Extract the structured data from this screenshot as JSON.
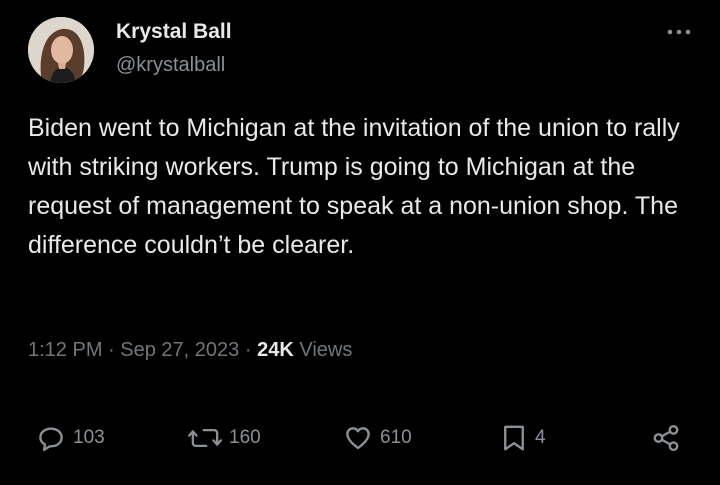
{
  "author": {
    "name": "Krystal Ball",
    "handle": "@krystalball"
  },
  "tweet": {
    "text": "Biden went to Michigan at the invitation of the union to rally with striking workers. Trump is going to Michigan at the request of management to speak at a non-union shop. The difference couldn’t be clearer.",
    "time": "1:12 PM",
    "separator": "·",
    "date": "Sep 27, 2023",
    "views_count": "24K",
    "views_label": "Views"
  },
  "actions": {
    "replies": "103",
    "reposts": "160",
    "likes": "610",
    "bookmarks": "4"
  },
  "icons": {
    "more": "more-horizontal-icon",
    "reply": "reply-icon",
    "repost": "repost-icon",
    "like": "heart-icon",
    "bookmark": "bookmark-icon",
    "share": "share-icon"
  },
  "colors": {
    "background": "#000000",
    "text_primary": "#e7e9ea",
    "text_secondary": "#71767b",
    "icon": "#8b9096"
  }
}
